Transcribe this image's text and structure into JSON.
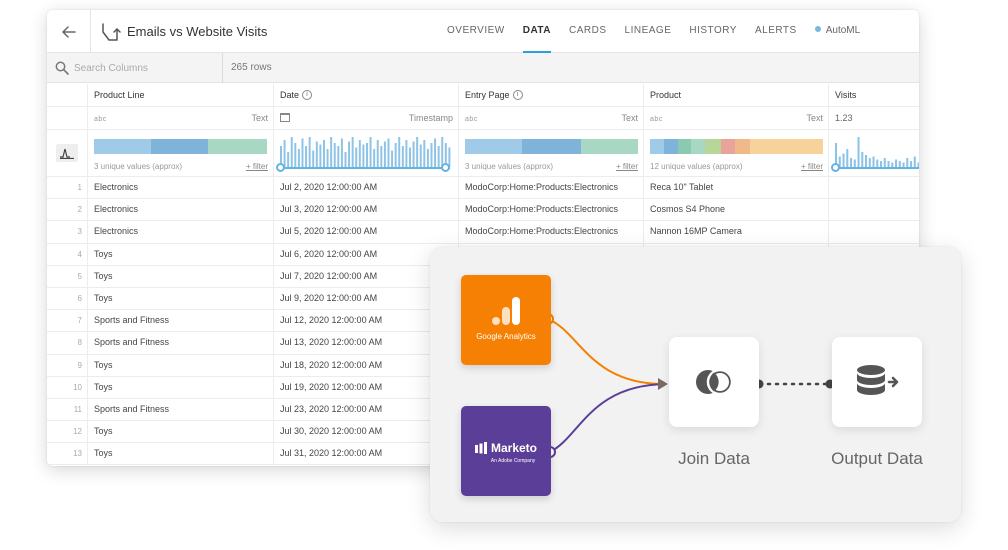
{
  "header": {
    "title": "Emails vs Website Visits",
    "tabs": [
      {
        "label": "OVERVIEW",
        "active": false
      },
      {
        "label": "DATA",
        "active": true
      },
      {
        "label": "CARDS",
        "active": false
      },
      {
        "label": "LINEAGE",
        "active": false
      },
      {
        "label": "HISTORY",
        "active": false
      },
      {
        "label": "ALERTS",
        "active": false
      },
      {
        "label": "AutoML",
        "active": false
      }
    ]
  },
  "search": {
    "placeholder": "Search Columns",
    "rows_label": "265 rows"
  },
  "columns": [
    {
      "name": "Product Line",
      "type_glyph": "abc",
      "type": "Text",
      "profile_text": "3 unique values (approx)",
      "filter_label": "+ filter"
    },
    {
      "name": "Date",
      "type_glyph": "",
      "type": "Timestamp",
      "profile_text": "",
      "filter_label": ""
    },
    {
      "name": "Entry Page",
      "type_glyph": "abc",
      "type": "Text",
      "profile_text": "3 unique values (approx)",
      "filter_label": "+ filter"
    },
    {
      "name": "Product",
      "type_glyph": "abc",
      "type": "Text",
      "profile_text": "12 unique values (approx)",
      "filter_label": "+ filter"
    },
    {
      "name": "Visits",
      "type_glyph": "1.23",
      "type": "",
      "profile_text": "",
      "filter_label": ""
    }
  ],
  "info_glyph": "i",
  "rows": [
    {
      "n": "1",
      "line": "Electronics",
      "date": "Jul 2, 2020 12:00:00 AM",
      "page": "ModoCorp:Home:Products:Electronics",
      "product": "Reca 10\" Tablet"
    },
    {
      "n": "2",
      "line": "Electronics",
      "date": "Jul 3, 2020 12:00:00 AM",
      "page": "ModoCorp:Home:Products:Electronics",
      "product": "Cosmos S4 Phone"
    },
    {
      "n": "3",
      "line": "Electronics",
      "date": "Jul 5, 2020 12:00:00 AM",
      "page": "ModoCorp:Home:Products:Electronics",
      "product": "Nannon 16MP Camera"
    },
    {
      "n": "4",
      "line": "Toys",
      "date": "Jul 6, 2020 12:00:00 AM",
      "page": "",
      "product": ""
    },
    {
      "n": "5",
      "line": "Toys",
      "date": "Jul 7, 2020 12:00:00 AM",
      "page": "",
      "product": ""
    },
    {
      "n": "6",
      "line": "Toys",
      "date": "Jul 9, 2020 12:00:00 AM",
      "page": "",
      "product": ""
    },
    {
      "n": "7",
      "line": "Sports and Fitness",
      "date": "Jul 12, 2020 12:00:00 AM",
      "page": "",
      "product": ""
    },
    {
      "n": "8",
      "line": "Sports and Fitness",
      "date": "Jul 13, 2020 12:00:00 AM",
      "page": "",
      "product": ""
    },
    {
      "n": "9",
      "line": "Toys",
      "date": "Jul 18, 2020 12:00:00 AM",
      "page": "",
      "product": ""
    },
    {
      "n": "10",
      "line": "Toys",
      "date": "Jul 19, 2020 12:00:00 AM",
      "page": "",
      "product": ""
    },
    {
      "n": "11",
      "line": "Sports and Fitness",
      "date": "Jul 23, 2020 12:00:00 AM",
      "page": "",
      "product": ""
    },
    {
      "n": "12",
      "line": "Toys",
      "date": "Jul 30, 2020 12:00:00 AM",
      "page": "",
      "product": ""
    },
    {
      "n": "13",
      "line": "Toys",
      "date": "Jul 31, 2020 12:00:00 AM",
      "page": "",
      "product": ""
    }
  ],
  "profiles": {
    "product_line_segments": [
      {
        "share": 0.33,
        "color": "#9fcbe8"
      },
      {
        "share": 0.33,
        "color": "#7fb3da"
      },
      {
        "share": 0.34,
        "color": "#a8d8c4"
      }
    ],
    "entry_page_segments": [
      {
        "share": 0.33,
        "color": "#9fcbe8"
      },
      {
        "share": 0.34,
        "color": "#7fb3da"
      },
      {
        "share": 0.33,
        "color": "#a8d8c4"
      }
    ],
    "product_segments": [
      {
        "share": 0.08,
        "color": "#9fcbe8"
      },
      {
        "share": 0.08,
        "color": "#7fb3da"
      },
      {
        "share": 0.08,
        "color": "#8cc9b3"
      },
      {
        "share": 0.08,
        "color": "#a8d8c4"
      },
      {
        "share": 0.09,
        "color": "#b9d69a"
      },
      {
        "share": 0.08,
        "color": "#e8a39b"
      },
      {
        "share": 0.09,
        "color": "#f1b98a"
      },
      {
        "share": 0.42,
        "color": "#f7d29a"
      }
    ],
    "date_histogram": [
      0.7,
      0.9,
      0.5,
      1,
      0.8,
      0.6,
      0.95,
      0.7,
      1,
      0.55,
      0.85,
      0.75,
      0.9,
      0.6,
      1,
      0.8,
      0.7,
      0.95,
      0.5,
      0.85,
      1,
      0.65,
      0.9,
      0.75,
      0.8,
      1,
      0.6,
      0.9,
      0.7,
      0.85,
      0.95,
      0.55,
      0.8,
      1,
      0.7,
      0.9,
      0.65,
      0.85,
      1,
      0.75,
      0.9,
      0.6,
      0.8,
      0.95,
      0.7,
      1,
      0.8,
      0.65
    ],
    "visits_histogram": [
      0.8,
      0.35,
      0.45,
      0.6,
      0.3,
      0.25,
      1,
      0.5,
      0.4,
      0.3,
      0.35,
      0.25,
      0.2,
      0.3,
      0.2,
      0.15,
      0.25,
      0.2,
      0.15,
      0.3,
      0.2,
      0.35,
      0.15,
      0.2
    ]
  },
  "flow": {
    "sources": [
      {
        "name": "Google Analytics",
        "color": "#f58003"
      },
      {
        "name": "Marketo",
        "sub": "An Adobe Company",
        "color": "#5b3e97"
      }
    ],
    "steps": [
      {
        "label": "Join Data"
      },
      {
        "label": "Output Data"
      }
    ],
    "connector_colors": {
      "google": "#f58003",
      "marketo": "#5b3e97"
    }
  },
  "colors": {
    "accent": "#2c9fd6",
    "automl_dot": "#79b9e0"
  }
}
